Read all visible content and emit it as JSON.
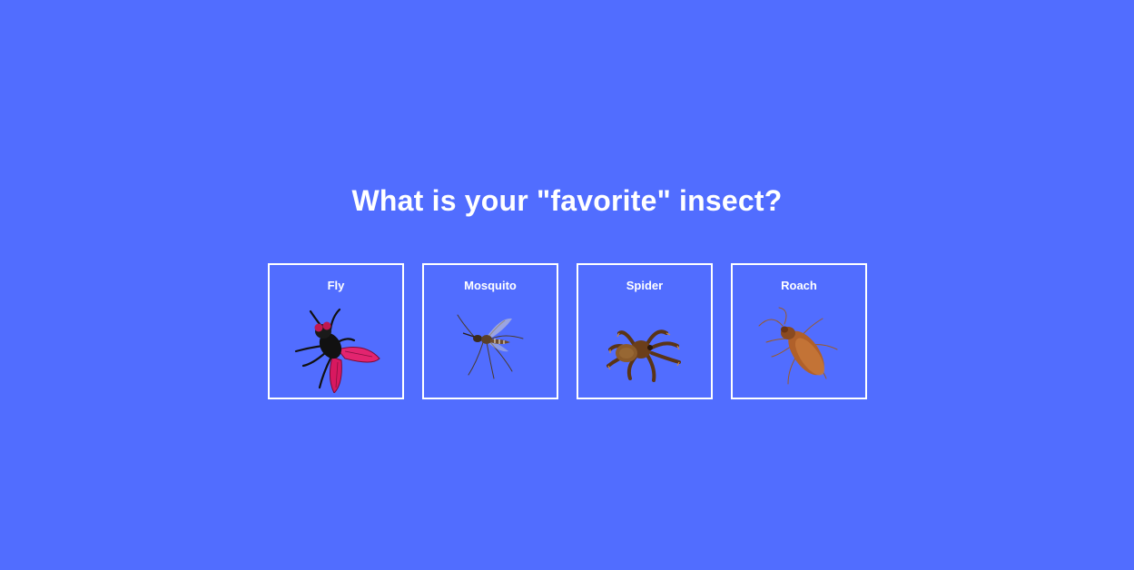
{
  "question": {
    "title": "What is your \"favorite\" insect?"
  },
  "choices": [
    {
      "label": "Fly",
      "icon": "fly-icon"
    },
    {
      "label": "Mosquito",
      "icon": "mosquito-icon"
    },
    {
      "label": "Spider",
      "icon": "spider-icon"
    },
    {
      "label": "Roach",
      "icon": "roach-icon"
    }
  ],
  "colors": {
    "background": "#516dff",
    "foreground": "#ffffff"
  }
}
